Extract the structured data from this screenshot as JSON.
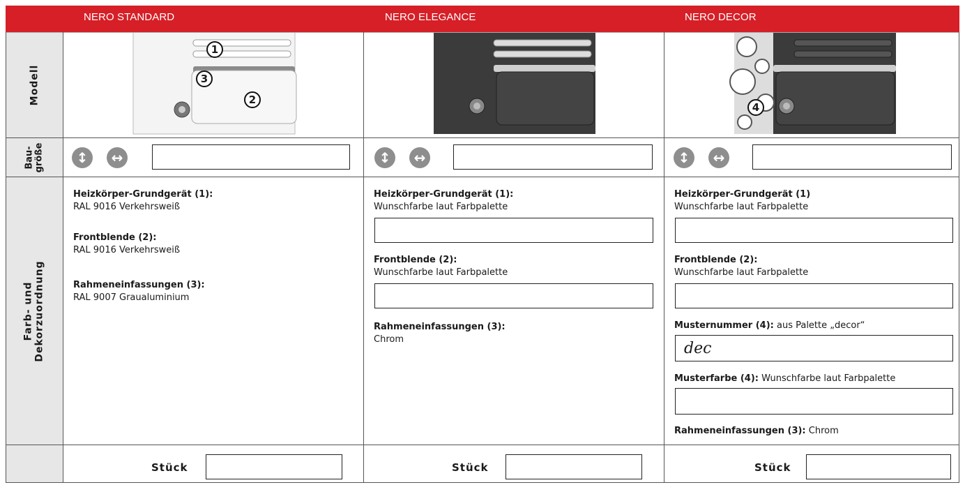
{
  "columns": [
    {
      "title": "NERO STANDARD"
    },
    {
      "title": "NERO ELEGANCE"
    },
    {
      "title": "NERO DECOR"
    }
  ],
  "rows": {
    "modell": "Modell",
    "baugroesse": "Bau-\ngröße",
    "farb": "Farb- und\nDekorzuordnung"
  },
  "markers": {
    "m1": "1",
    "m2": "2",
    "m3": "3",
    "m4": "4"
  },
  "standard": {
    "h1": "Heizkörper-Grundgerät (1):",
    "v1": "RAL 9016 Verkehrsweiß",
    "h2": "Frontblende (2):",
    "v2": "RAL 9016 Verkehrsweiß",
    "h3": "Rahmeneinfassungen (3):",
    "v3": "RAL 9007 Graualuminium"
  },
  "elegance": {
    "h1": "Heizkörper-Grundgerät (1):",
    "v1": "Wunschfarbe laut Farbpalette",
    "h2": "Frontblende (2):",
    "v2": "Wunschfarbe laut Farbpalette",
    "h3": "Rahmeneinfassungen (3):",
    "v3": "Chrom"
  },
  "decor": {
    "h1": "Heizkörper-Grundgerät (1)",
    "v1": "Wunschfarbe laut Farbpalette",
    "h2": "Frontblende (2):",
    "v2": "Wunschfarbe laut Farbpalette",
    "h4": "Musternummer (4):",
    "v4": " aus Palette „decor“",
    "muster_value": "dec",
    "h5": "Musterfarbe (4):",
    "v5": " Wunschfarbe laut Farbpalette",
    "h3": "Rahmeneinfassungen (3):",
    "v3": " Chrom"
  },
  "stueck_label": "Stück",
  "colors": {
    "accent": "#d61f27",
    "side": "#e7e7e7",
    "icon": "#8e8e8e"
  },
  "icons": {
    "vertical": "vertical-size-icon",
    "horizontal": "horizontal-size-icon"
  }
}
